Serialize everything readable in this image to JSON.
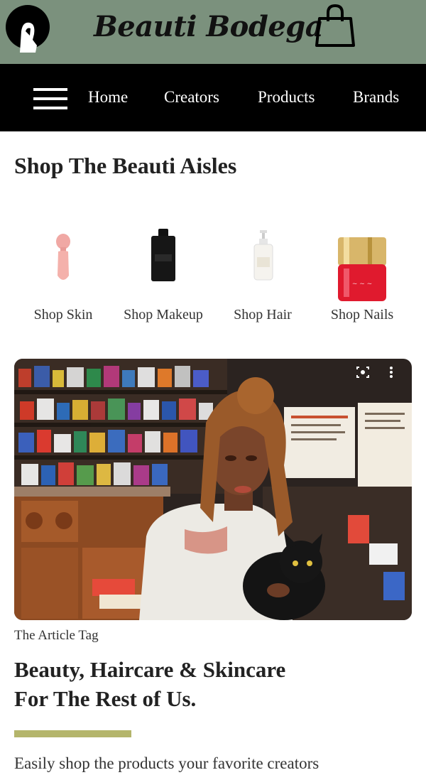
{
  "header": {
    "brand": "Beauti Bodega",
    "background": "#7b917d"
  },
  "nav": {
    "menu_icon": "hamburger-menu-icon",
    "links": [
      "Home",
      "Creators",
      "Products",
      "Brands"
    ]
  },
  "aisles": {
    "title": "Shop The Beauti Aisles",
    "items": [
      {
        "label": "Shop Skin",
        "icon": "skin-tool-icon"
      },
      {
        "label": "Shop Makeup",
        "icon": "makeup-bottle-icon"
      },
      {
        "label": "Shop Hair",
        "icon": "hair-lotion-icon"
      },
      {
        "label": "Shop Nails",
        "icon": "nail-polish-icon"
      }
    ]
  },
  "article": {
    "tag": "The Article Tag",
    "title_line1": "Beauty, Haircare & Skincare",
    "title_line2": "For The Rest of Us.",
    "excerpt": "Easily shop the products your favorite creators",
    "accent_color": "#b4b56b"
  }
}
